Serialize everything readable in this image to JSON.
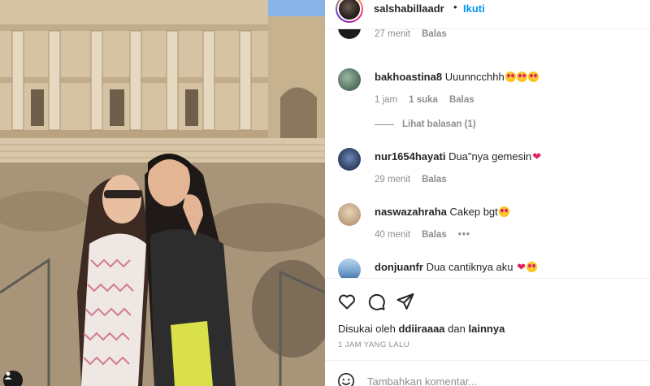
{
  "post": {
    "image_alt": "Two women posing in front of the Library of Celsus ruins"
  },
  "header": {
    "username": "salshabillaadr",
    "separator": "•",
    "follow_label": "Ikuti"
  },
  "comments": [
    {
      "username": "",
      "text": "",
      "time": "27 menit",
      "likes": "",
      "reply_label": "Balas"
    },
    {
      "username": "bakhoastina8",
      "text": "Uuunncchhh",
      "emoji": "heart-eyes-x3",
      "time": "1 jam",
      "likes": "1 suka",
      "reply_label": "Balas",
      "view_replies": "Lihat balasan (1)"
    },
    {
      "username": "nur1654hayati",
      "text": "Dua\"nya gemesin",
      "emoji": "red-heart",
      "time": "29 menit",
      "reply_label": "Balas"
    },
    {
      "username": "naswazahraha",
      "text": "Cakep bgt",
      "emoji": "heart-eyes",
      "time": "40 menit",
      "reply_label": "Balas",
      "more": "•••"
    },
    {
      "username": "donjuanfr",
      "text": "Dua cantiknya aku",
      "emoji": "red-heart heart-eyes"
    }
  ],
  "actions": {
    "like_icon": "heart-outline-icon",
    "comment_icon": "comment-bubble-icon",
    "share_icon": "paper-plane-icon"
  },
  "likes": {
    "prefix": "Disukai oleh",
    "user": "ddiiraaaa",
    "and": "dan",
    "others": "lainnya"
  },
  "timestamp": "1 JAM YANG LALU",
  "composer": {
    "placeholder": "Tambahkan komentar..."
  },
  "colors": {
    "accent": "#0095f6",
    "text": "#262626",
    "muted": "#8e8e8e",
    "divider": "#efefef"
  }
}
